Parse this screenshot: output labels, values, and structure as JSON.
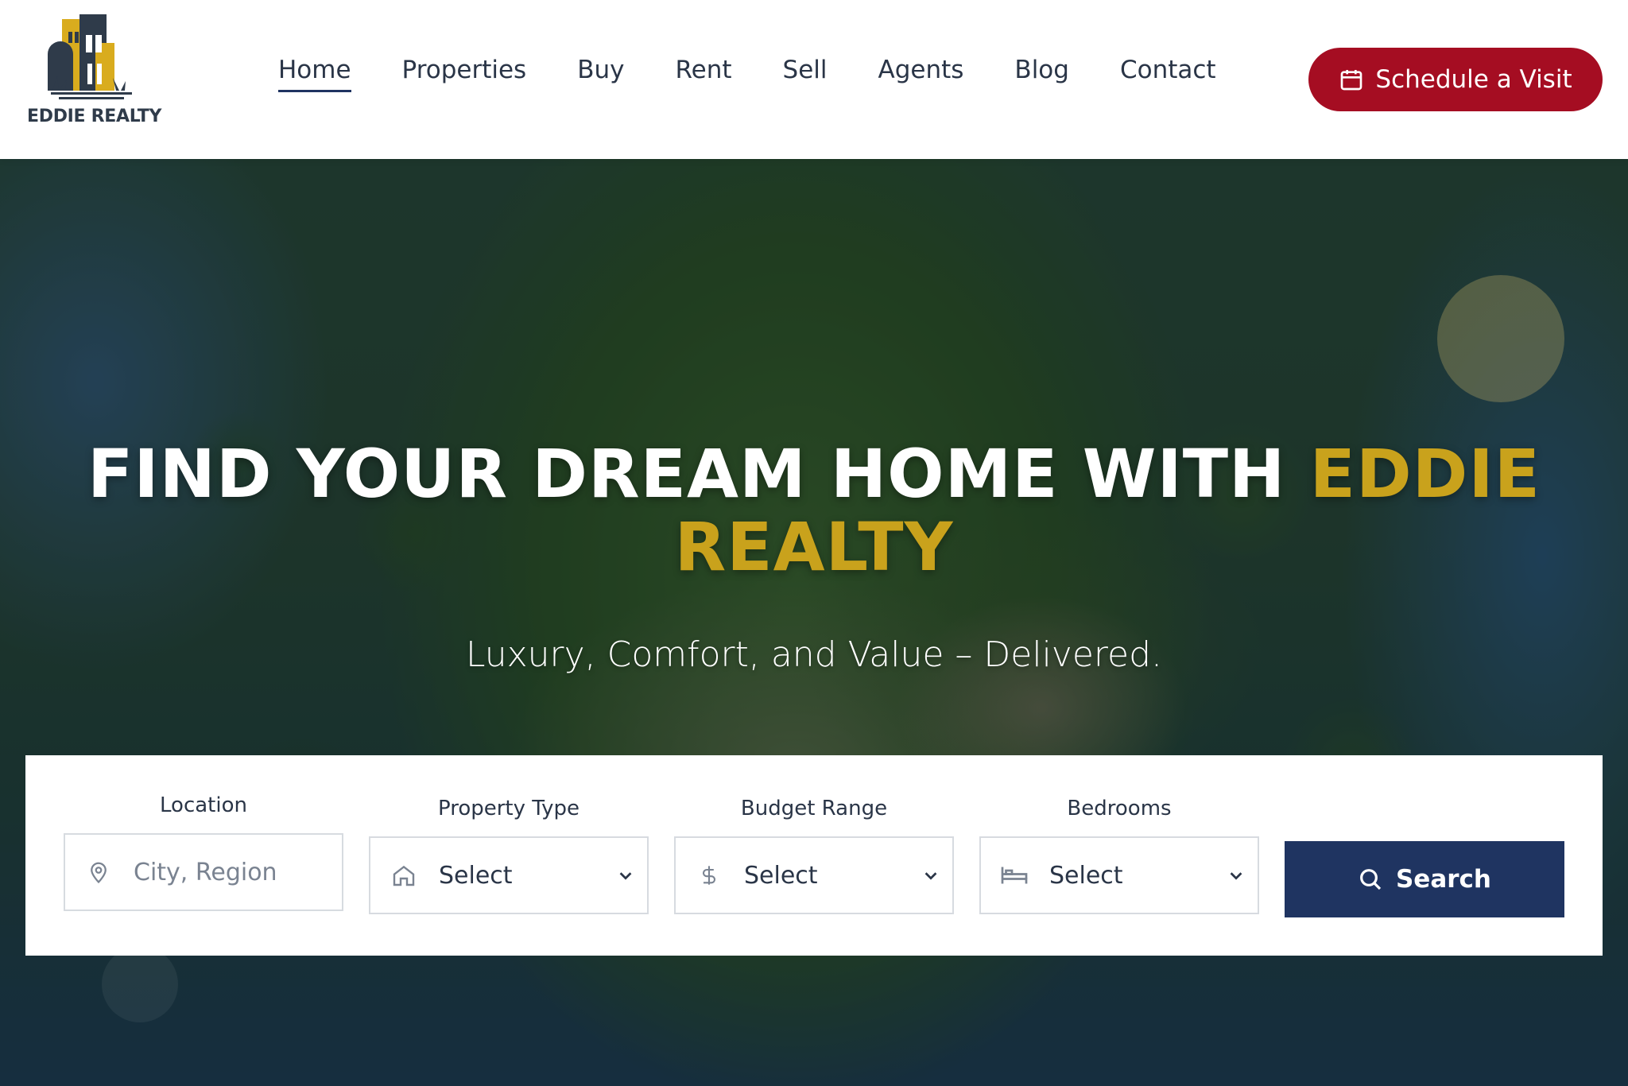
{
  "brand": {
    "name": "EDDIE REALTY",
    "accent_color": "#c9a21c",
    "primary_color": "#1f3461",
    "cta_color": "#a50d22"
  },
  "nav": {
    "items": [
      {
        "label": "Home",
        "active": true
      },
      {
        "label": "Properties"
      },
      {
        "label": "Buy"
      },
      {
        "label": "Rent"
      },
      {
        "label": "Sell"
      },
      {
        "label": "Agents"
      },
      {
        "label": "Blog"
      },
      {
        "label": "Contact"
      }
    ],
    "cta_label": "Schedule a Visit",
    "cta_icon": "calendar-icon"
  },
  "hero": {
    "title_main": "FIND YOUR DREAM HOME WITH ",
    "title_accent": "EDDIE REALTY",
    "subtitle": "Luxury, Comfort, and Value – Delivered."
  },
  "search": {
    "fields": [
      {
        "label": "Location",
        "placeholder": "City, Region",
        "icon": "map-pin-icon"
      },
      {
        "label": "Property Type",
        "value": "Select",
        "icon": "home-icon"
      },
      {
        "label": "Budget Range",
        "value": "Select",
        "icon": "dollar-icon"
      },
      {
        "label": "Bedrooms",
        "value": "Select",
        "icon": "bed-icon"
      }
    ],
    "button_label": "Search",
    "button_icon": "search-icon"
  }
}
